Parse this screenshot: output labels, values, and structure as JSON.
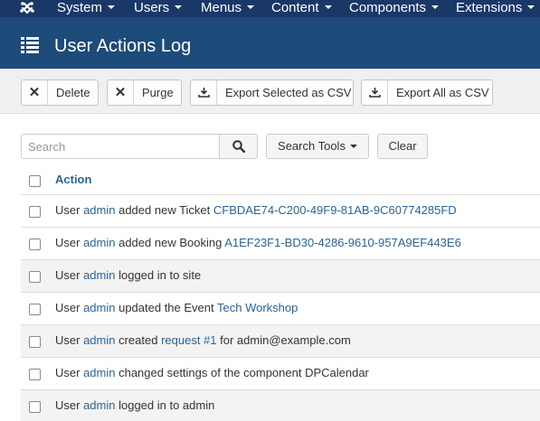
{
  "nav": {
    "items": [
      "System",
      "Users",
      "Menus",
      "Content",
      "Components",
      "Extensions"
    ]
  },
  "title": "User Actions Log",
  "toolbar": {
    "delete_label": "Delete",
    "purge_label": "Purge",
    "export_selected_label": "Export Selected as CSV",
    "export_all_label": "Export All as CSV"
  },
  "search": {
    "placeholder": "Search",
    "search_tools_label": "Search Tools",
    "clear_label": "Clear"
  },
  "table": {
    "header": "Action",
    "rows": [
      {
        "pre": "User ",
        "user": "admin",
        "mid": " added new Ticket ",
        "link": "CFBDAE74-C200-49F9-81AB-9C60774285FD",
        "post": ""
      },
      {
        "pre": "User ",
        "user": "admin",
        "mid": " added new Booking ",
        "link": "A1EF23F1-BD30-4286-9610-957A9EF443E6",
        "post": ""
      },
      {
        "pre": "User ",
        "user": "admin",
        "mid": " logged in to site",
        "link": "",
        "post": ""
      },
      {
        "pre": "User ",
        "user": "admin",
        "mid": " updated the Event ",
        "link": "Tech Workshop",
        "post": ""
      },
      {
        "pre": "User ",
        "user": "admin",
        "mid": " created ",
        "link": "request #1",
        "post": " for admin@example.com"
      },
      {
        "pre": "User ",
        "user": "admin",
        "mid": " changed settings of the component DPCalendar",
        "link": "",
        "post": ""
      },
      {
        "pre": "User ",
        "user": "admin",
        "mid": " logged in to admin",
        "link": "",
        "post": ""
      }
    ]
  },
  "colors": {
    "navbar": "#1a3867",
    "titlebar": "#1d4b7a",
    "link": "#2a6496",
    "row_alt": "#f3f3f3"
  }
}
